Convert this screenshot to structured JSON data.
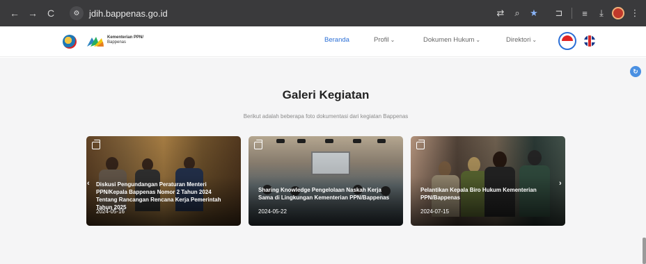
{
  "browser": {
    "url": "jdih.bappenas.go.id",
    "back_icon": "←",
    "forward_icon": "→",
    "reload_icon": "C",
    "site_info_icon": "⚙",
    "translate_icon": "⇄",
    "zoom_icon": "⌕",
    "bookmark_icon": "★",
    "extensions_icon": "⊐",
    "tabs_icon": "≡",
    "download_icon": "⤓",
    "menu_icon": "⋮"
  },
  "header": {
    "logo_line1": "Kementerian PPN/",
    "logo_line2": "Bappenas",
    "nav": [
      {
        "label": "Beranda",
        "active": true
      },
      {
        "label": "Profil",
        "chevron": "⌄"
      },
      {
        "label": "Dokumen Hukum",
        "chevron": "⌄"
      },
      {
        "label": "Direktori",
        "chevron": "⌄"
      }
    ]
  },
  "gallery": {
    "title": "Galeri Kegiatan",
    "subtitle": "Berikut adalah beberapa foto dokumentasi dari kegiatan Bappenas",
    "prev_icon": "‹",
    "next_icon": "›",
    "cards": [
      {
        "caption": "Diskusi Pengundangan Peraturan Menteri PPN/Kepala Bappenas Nomor 2 Tahun 2024 Tentang Rancangan Rencana Kerja Pemerintah Tahun 2025",
        "date": "2024-05-16"
      },
      {
        "caption": "Sharing Knowledge Pengelolaan Naskah Kerja Sama di Lingkungan Kementerian PPN/Bappenas",
        "date": "2024-05-22"
      },
      {
        "caption": "Pelantikan Kepala Biro Hukum Kementerian PPN/Bappenas",
        "date": "2024-07-15"
      }
    ]
  },
  "floating_button_icon": "↻",
  "colors": {
    "accent": "#2b6fd6",
    "chrome_bg": "#3a3a3c",
    "section_bg": "#f5f5f6"
  }
}
